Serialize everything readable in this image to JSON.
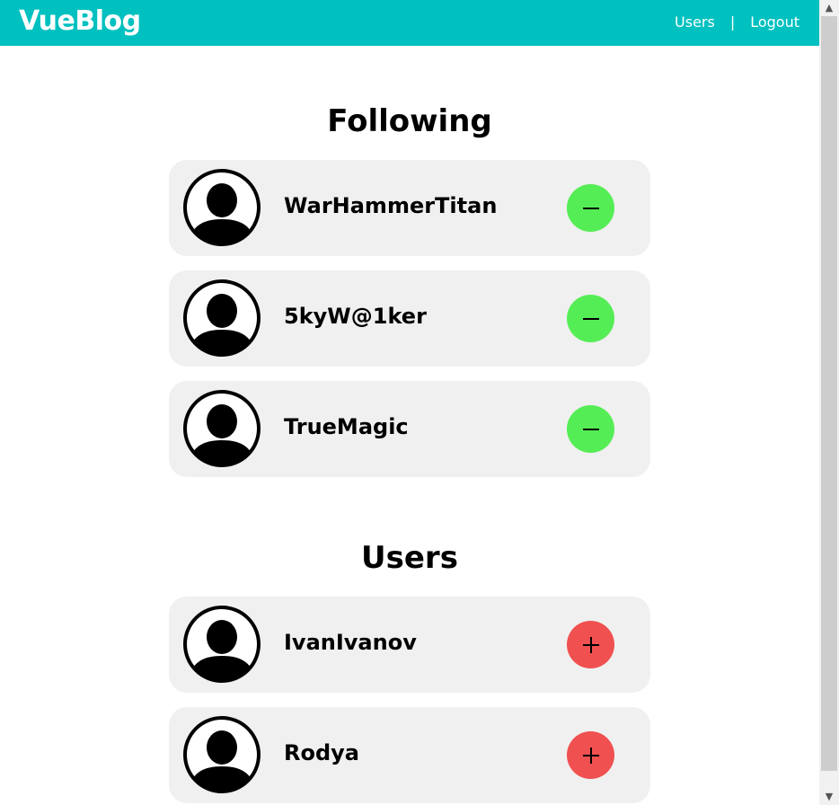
{
  "header": {
    "logo": "VueBlog",
    "nav": {
      "users": "Users",
      "separator": "|",
      "logout": "Logout"
    }
  },
  "following": {
    "title": "Following",
    "items": [
      {
        "username": "WarHammerTitan",
        "action_icon": "minus-icon"
      },
      {
        "username": "5kyW@1ker",
        "action_icon": "minus-icon"
      },
      {
        "username": "TrueMagic",
        "action_icon": "minus-icon"
      }
    ]
  },
  "users": {
    "title": "Users",
    "items": [
      {
        "username": "IvanIvanov",
        "action_icon": "plus-icon"
      },
      {
        "username": "Rodya",
        "action_icon": "plus-icon"
      }
    ]
  },
  "colors": {
    "header": "#00c0c0",
    "unfollow_button": "#55ed55",
    "follow_button": "#f05050",
    "card_bg": "#f0f0f0"
  }
}
